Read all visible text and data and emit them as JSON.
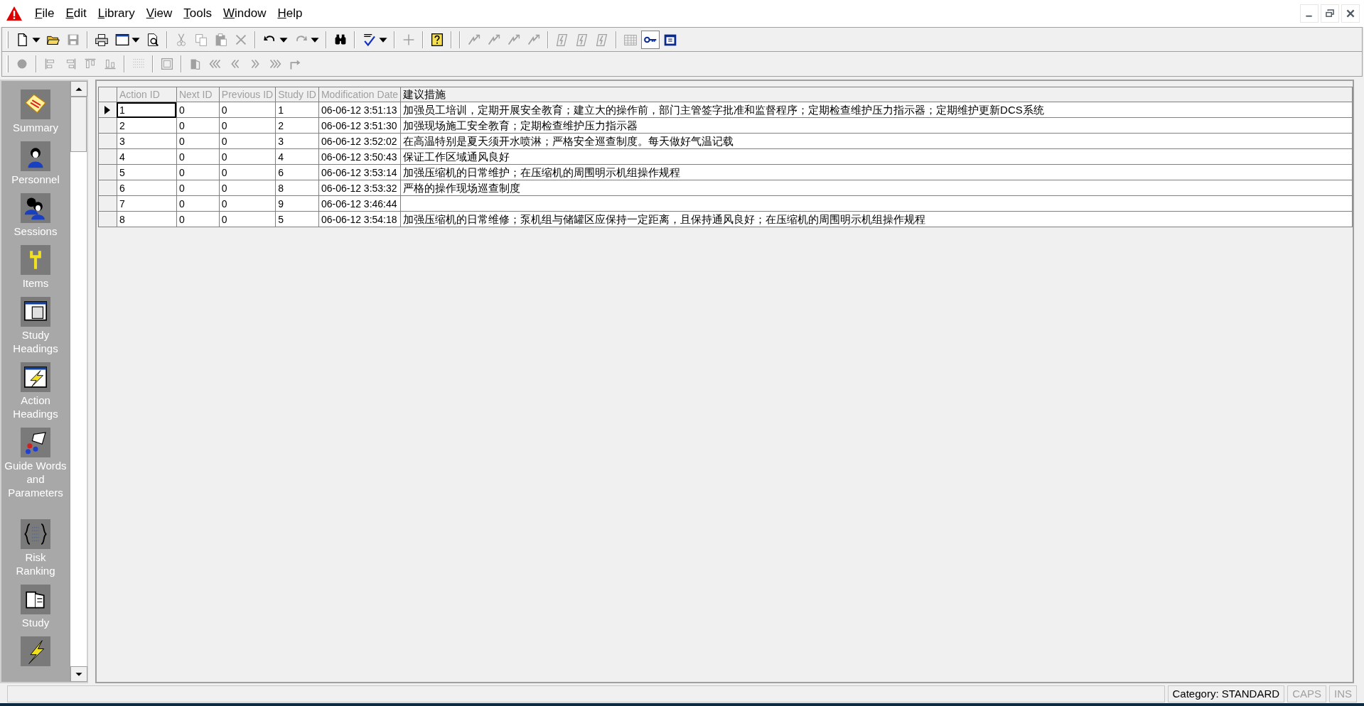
{
  "menu": [
    {
      "label": "File"
    },
    {
      "label": "Edit"
    },
    {
      "label": "Library"
    },
    {
      "label": "View"
    },
    {
      "label": "Tools"
    },
    {
      "label": "Window"
    },
    {
      "label": "Help"
    }
  ],
  "toolbar_1": [
    {
      "kind": "new",
      "disabled": false,
      "dropdown": true
    },
    {
      "kind": "open",
      "disabled": false,
      "dropdown": false
    },
    {
      "kind": "save",
      "disabled": true,
      "dropdown": false
    },
    {
      "kind": "separator"
    },
    {
      "kind": "print",
      "disabled": false,
      "dropdown": false
    },
    {
      "kind": "view",
      "disabled": false,
      "dropdown": true
    },
    {
      "kind": "preview",
      "disabled": false,
      "dropdown": false
    },
    {
      "kind": "separator"
    },
    {
      "kind": "cut",
      "disabled": true,
      "dropdown": false
    },
    {
      "kind": "copy",
      "disabled": true,
      "dropdown": false
    },
    {
      "kind": "paste",
      "disabled": true,
      "dropdown": false
    },
    {
      "kind": "delete",
      "disabled": true,
      "dropdown": false
    },
    {
      "kind": "separator"
    },
    {
      "kind": "undo",
      "disabled": false,
      "dropdown": true
    },
    {
      "kind": "redo",
      "disabled": true,
      "dropdown": true
    },
    {
      "kind": "separator"
    },
    {
      "kind": "find",
      "disabled": false,
      "dropdown": false
    },
    {
      "kind": "separator"
    },
    {
      "kind": "spell",
      "disabled": false,
      "dropdown": true
    },
    {
      "kind": "separator"
    },
    {
      "kind": "add",
      "disabled": true,
      "dropdown": false
    },
    {
      "kind": "separator"
    },
    {
      "kind": "help",
      "disabled": false,
      "dropdown": false
    },
    {
      "kind": "separator"
    },
    {
      "kind": "separator"
    },
    {
      "kind": "link",
      "disabled": true,
      "dropdown": false
    },
    {
      "kind": "link",
      "disabled": true,
      "dropdown": false
    },
    {
      "kind": "link",
      "disabled": true,
      "dropdown": false
    },
    {
      "kind": "link",
      "disabled": true,
      "dropdown": false
    },
    {
      "kind": "separator"
    },
    {
      "kind": "flag",
      "disabled": true,
      "dropdown": false
    },
    {
      "kind": "flag",
      "disabled": true,
      "dropdown": false
    },
    {
      "kind": "flag",
      "disabled": true,
      "dropdown": false
    },
    {
      "kind": "separator"
    },
    {
      "kind": "grid",
      "disabled": true,
      "dropdown": false
    },
    {
      "kind": "key",
      "disabled": false,
      "dropdown": false,
      "pressed": true
    },
    {
      "kind": "calendar",
      "disabled": false,
      "dropdown": false,
      "pressed": false
    }
  ],
  "toolbar_2": [
    {
      "kind": "record",
      "disabled": true
    },
    {
      "kind": "separator"
    },
    {
      "kind": "align-left",
      "disabled": true
    },
    {
      "kind": "align-right",
      "disabled": true
    },
    {
      "kind": "align-top",
      "disabled": true
    },
    {
      "kind": "align-bottom",
      "disabled": true
    },
    {
      "kind": "separator"
    },
    {
      "kind": "dots",
      "disabled": true
    },
    {
      "kind": "separator"
    },
    {
      "kind": "frame",
      "disabled": true
    },
    {
      "kind": "separator"
    },
    {
      "kind": "book",
      "disabled": true
    },
    {
      "kind": "first",
      "disabled": true
    },
    {
      "kind": "prev",
      "disabled": true
    },
    {
      "kind": "next",
      "disabled": true
    },
    {
      "kind": "last",
      "disabled": true
    },
    {
      "kind": "jump",
      "disabled": true
    }
  ],
  "sidebar": {
    "items": [
      {
        "kind": "summary",
        "label": "Summary"
      },
      {
        "kind": "person",
        "label": "Personnel"
      },
      {
        "kind": "people",
        "label": "Sessions"
      },
      {
        "kind": "wrench",
        "label": "Items"
      },
      {
        "kind": "window",
        "label": "Study Headings"
      },
      {
        "kind": "bolt-window",
        "label": "Action Headings"
      },
      {
        "kind": "guide",
        "label": "Guide Words and Parameters"
      },
      {
        "kind": "braces",
        "label": "Risk Ranking"
      },
      {
        "kind": "book",
        "label": "Study"
      },
      {
        "kind": "bolt"
      }
    ]
  },
  "table": {
    "columns": [
      {
        "label": "Action ID",
        "readonly": true
      },
      {
        "label": "Next ID",
        "readonly": true
      },
      {
        "label": "Previous ID",
        "readonly": true
      },
      {
        "label": "Study ID",
        "readonly": true
      },
      {
        "label": "Modification Date",
        "readonly": true
      },
      {
        "label": "建议措施",
        "readonly": false
      }
    ],
    "rows": [
      {
        "selected": true,
        "cells": [
          "1",
          "0",
          "0",
          "1",
          "06-06-12 3:51:13",
          "加强员工培训，定期开展安全教育；建立大的操作前，部门主管签字批准和监督程序；定期检查维护压力指示器；定期维护更新DCS系统"
        ]
      },
      {
        "selected": false,
        "cells": [
          "2",
          "0",
          "0",
          "2",
          "06-06-12 3:51:30",
          "加强现场施工安全教育；定期检查维护压力指示器"
        ]
      },
      {
        "selected": false,
        "cells": [
          "3",
          "0",
          "0",
          "3",
          "06-06-12 3:52:02",
          "在高温特别是夏天须开水喷淋；严格安全巡查制度。每天做好气温记载"
        ]
      },
      {
        "selected": false,
        "cells": [
          "4",
          "0",
          "0",
          "4",
          "06-06-12 3:50:43",
          "保证工作区域通风良好"
        ]
      },
      {
        "selected": false,
        "cells": [
          "5",
          "0",
          "0",
          "6",
          "06-06-12 3:53:14",
          "加强压缩机的日常维护；在压缩机的周围明示机组操作规程"
        ]
      },
      {
        "selected": false,
        "cells": [
          "6",
          "0",
          "0",
          "8",
          "06-06-12 3:53:32",
          "严格的操作现场巡查制度"
        ]
      },
      {
        "selected": false,
        "cells": [
          "7",
          "0",
          "0",
          "9",
          "06-06-12 3:46:44",
          ""
        ]
      },
      {
        "selected": false,
        "cells": [
          "8",
          "0",
          "0",
          "5",
          "06-06-12 3:54:18",
          "加强压缩机的日常维修；泵机组与储罐区应保持一定距离，且保持通风良好；在压缩机的周围明示机组操作规程"
        ]
      }
    ]
  },
  "status_bar": [
    {
      "text": "Category: STANDARD",
      "active": true
    },
    {
      "text": "CAPS",
      "active": false
    },
    {
      "text": "INS",
      "active": false
    }
  ]
}
